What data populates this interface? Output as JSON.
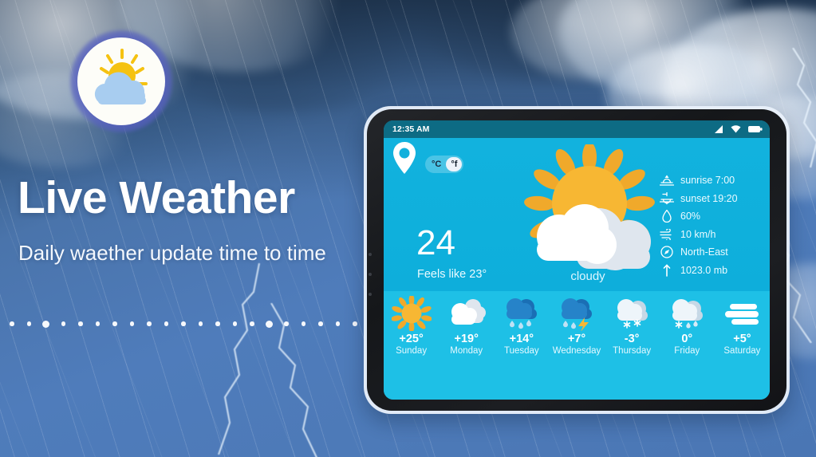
{
  "background": {
    "scene": "stormy-sky-with-rain-and-lightning",
    "colors": {
      "sky_top": "#243e5c",
      "sky_bottom": "#4a76b4"
    }
  },
  "left_panel": {
    "logo": {
      "icon": "sun-behind-cloud-icon",
      "ring_color": "#5660be",
      "disc_color": "#fdfdf8",
      "sun_color": "#f5c211",
      "cloud_color": "#a8cdf0"
    },
    "headline": "Live Weather",
    "subline": "Daily waether update time to time",
    "dots": {
      "count": 21,
      "large_indexes": [
        2,
        15
      ],
      "color": "#ffffff"
    }
  },
  "tablet": {
    "status_bar": {
      "time": "12:35 AM",
      "icons": [
        "signal-icon",
        "wifi-icon",
        "battery-icon"
      ],
      "background": "#0d6b84"
    },
    "current": {
      "location_icon": "location-pin-icon",
      "unit_toggle": {
        "options": [
          {
            "label": "°C",
            "selected": false
          },
          {
            "label": "°f",
            "selected": true
          }
        ]
      },
      "temperature": "24",
      "feels_like": "Feels like 23°",
      "condition": "cloudy",
      "weather_icon": "sun-behind-clouds-icon",
      "panel_color": "#12b0dc"
    },
    "details": [
      {
        "icon": "sunrise-icon",
        "text": "sunrise 7:00"
      },
      {
        "icon": "sunset-icon",
        "text": "sunset 19:20"
      },
      {
        "icon": "humidity-icon",
        "text": "60%"
      },
      {
        "icon": "wind-icon",
        "text": "10 km/h"
      },
      {
        "icon": "compass-icon",
        "text": "North-East"
      },
      {
        "icon": "pressure-icon",
        "text": "1023.0 mb"
      }
    ],
    "forecast": {
      "background": "#1ec0e6",
      "days": [
        {
          "day": "Sunday",
          "temp": "+25°",
          "icon": "sunny-icon"
        },
        {
          "day": "Monday",
          "temp": "+19°",
          "icon": "partly-cloudy-icon"
        },
        {
          "day": "Tuesday",
          "temp": "+14°",
          "icon": "rain-icon"
        },
        {
          "day": "Wednesday",
          "temp": "+7°",
          "icon": "thunderstorm-icon"
        },
        {
          "day": "Thursday",
          "temp": "-3°",
          "icon": "snow-icon"
        },
        {
          "day": "Friday",
          "temp": "0°",
          "icon": "sleet-icon"
        },
        {
          "day": "Saturday",
          "temp": "+5°",
          "icon": "windy-icon"
        }
      ]
    }
  }
}
